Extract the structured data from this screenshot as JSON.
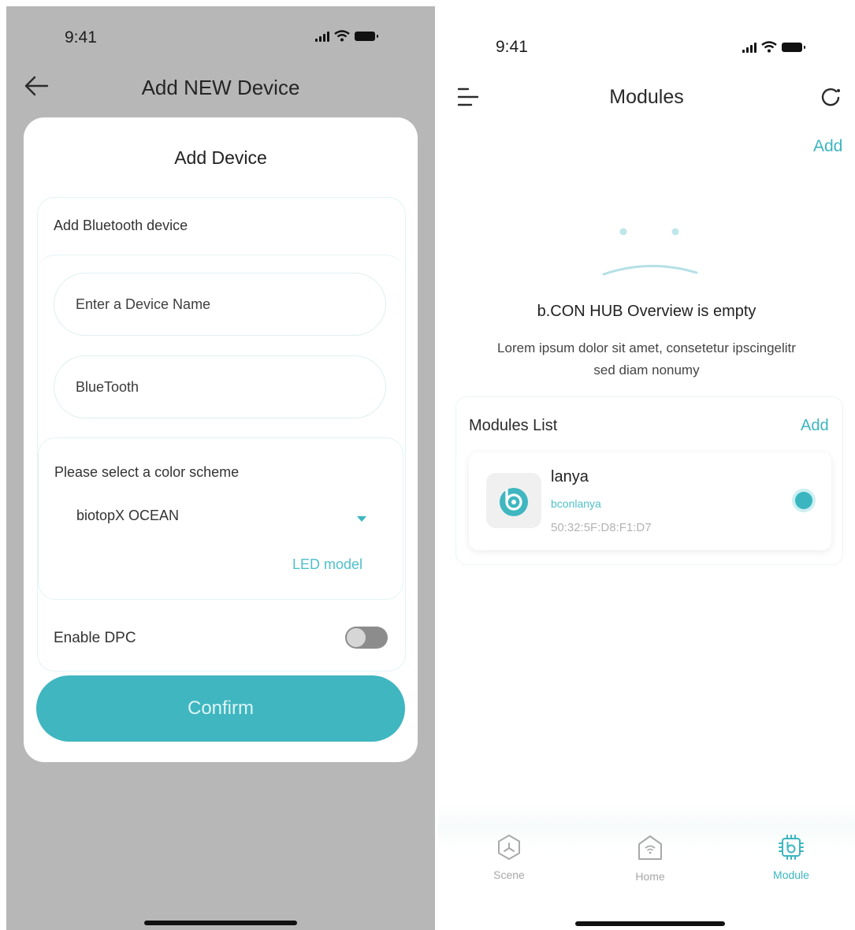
{
  "left_screen": {
    "status": {
      "time": "9:41"
    },
    "header": {
      "title": "Add NEW Device"
    },
    "card": {
      "title": "Add Device",
      "bluetooth_section_label": "Add Bluetooth device",
      "device_name_placeholder": "Enter a Device Name",
      "bluetooth_value": "BlueTooth",
      "color_scheme_label": "Please select a color scheme",
      "color_scheme_selected": "biotopX OCEAN",
      "led_model_link": "LED model",
      "enable_dpc_label": "Enable DPC",
      "enable_dpc_on": false,
      "confirm_label": "Confirm"
    }
  },
  "right_screen": {
    "status": {
      "time": "9:41"
    },
    "header": {
      "title": "Modules",
      "add_label": "Add"
    },
    "empty_state": {
      "title": "b.CON HUB Overview is empty",
      "description": "Lorem ipsum dolor sit amet, consetetur ipscingelitr sed diam nonumy"
    },
    "modules_list": {
      "title": "Modules List",
      "add_label": "Add",
      "items": [
        {
          "name": "lanya",
          "subtitle": "bconlanya",
          "mac": "50:32:5F:D8:F1:D7",
          "selected": true
        }
      ]
    },
    "tab_bar": {
      "tabs": [
        {
          "label": "Scene",
          "icon": "scene-icon",
          "active": false
        },
        {
          "label": "Home",
          "icon": "home-icon",
          "active": false
        },
        {
          "label": "Module",
          "icon": "module-icon",
          "active": true
        }
      ]
    }
  },
  "colors": {
    "accent": "#3bb6c0",
    "overlay": "#b7b7b7"
  }
}
